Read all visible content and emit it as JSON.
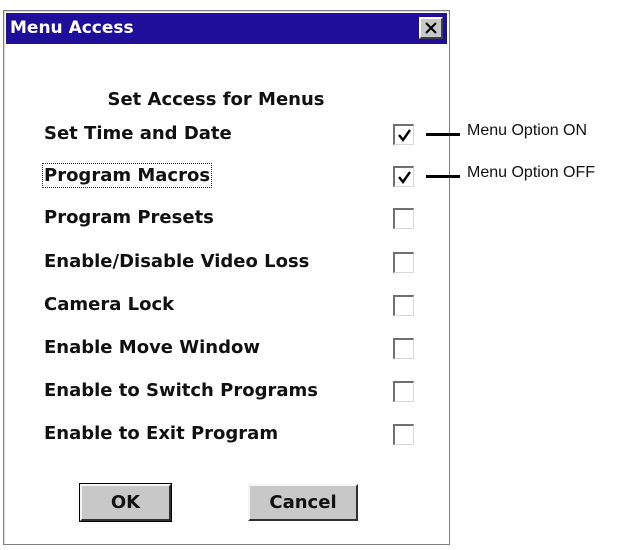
{
  "window": {
    "title": "Menu Access",
    "close_icon": "close-icon"
  },
  "heading": "Set Access for Menus",
  "options": [
    {
      "label": "Set Time and Date",
      "checked": true
    },
    {
      "label": "Program Macros",
      "checked": true
    },
    {
      "label": "Program Presets",
      "checked": false
    },
    {
      "label": "Enable/Disable Video Loss",
      "checked": false
    },
    {
      "label": "Camera Lock",
      "checked": false
    },
    {
      "label": "Enable Move Window",
      "checked": false
    },
    {
      "label": "Enable to Switch Programs",
      "checked": false
    },
    {
      "label": "Enable to Exit Program",
      "checked": false
    }
  ],
  "buttons": {
    "ok": "OK",
    "cancel": "Cancel"
  },
  "callouts": {
    "on": "Menu Option ON",
    "off": "Menu Option OFF"
  },
  "colors": {
    "titlebar": "#1f0e9a",
    "button_face": "#c8c8c8"
  }
}
